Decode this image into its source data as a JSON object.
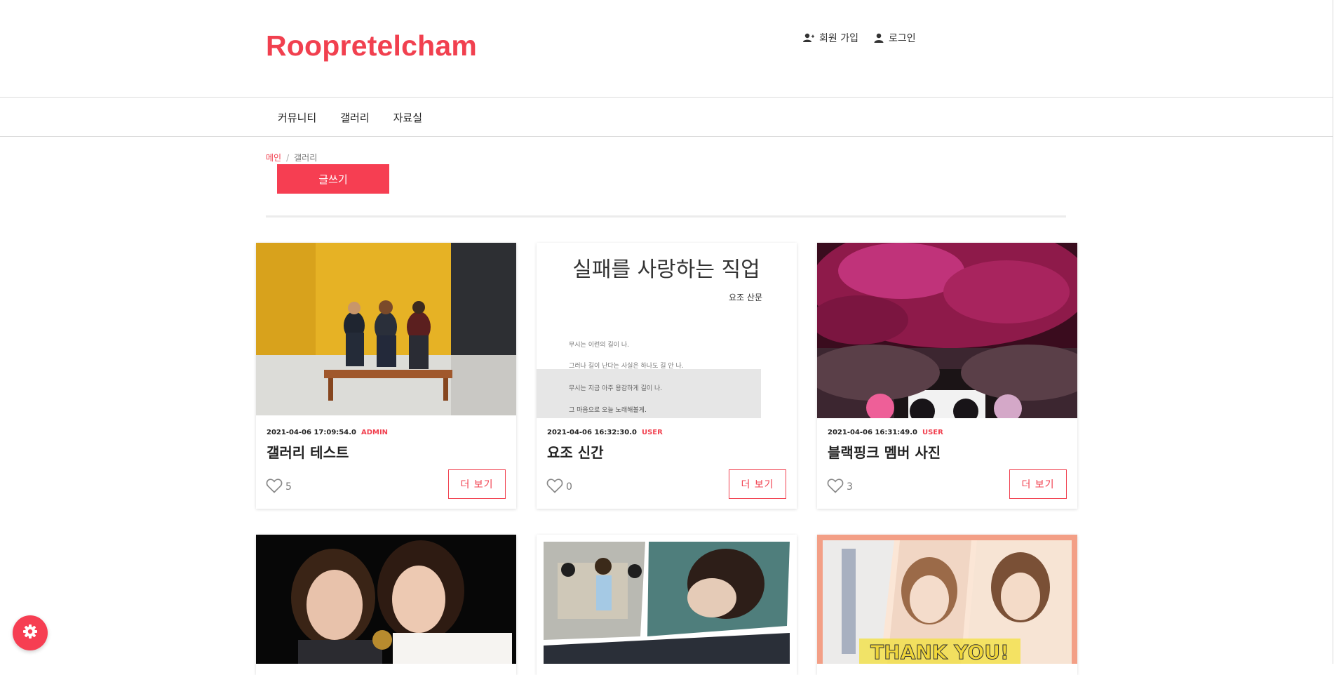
{
  "site": {
    "brand": "Roopretelcham"
  },
  "user_links": {
    "signup": "회원 가입",
    "login": "로그인"
  },
  "nav": {
    "items": [
      "커뮤니티",
      "갤러리",
      "자료실"
    ]
  },
  "breadcrumb": {
    "home": "메인",
    "separator": "/",
    "current": "갤러리"
  },
  "actions": {
    "write": "글쓰기"
  },
  "posts": [
    {
      "date": "2021-04-06 17:09:54.0",
      "role": "ADMIN",
      "title": "갤러리 테스트",
      "likes": "5",
      "more": "더 보기"
    },
    {
      "date": "2021-04-06 16:32:30.0",
      "role": "USER",
      "title": "요조 신간",
      "likes": "0",
      "more": "더 보기"
    },
    {
      "date": "2021-04-06 16:31:49.0",
      "role": "USER",
      "title": "블랙핑크 멤버 사진",
      "likes": "3",
      "more": "더 보기"
    }
  ],
  "book_cover": {
    "title": "실패를 사랑하는 직업",
    "author": "요조 산문",
    "lines": [
      "무시는 이런의 길이 나.",
      "그러나 길이 난다는 사실은 하나도 길 안 나.",
      "무시는 지금 아주 용감하게 길이 나.",
      "그 마음으로 오늘 노래해볼게."
    ]
  },
  "poster_text": "THANK YOU!",
  "colors": {
    "accent": "#f1404f",
    "button": "#f63e52"
  },
  "icons": {
    "signup": "user-plus-icon",
    "login": "user-icon",
    "like": "heart-icon",
    "settings": "gear-icon"
  }
}
